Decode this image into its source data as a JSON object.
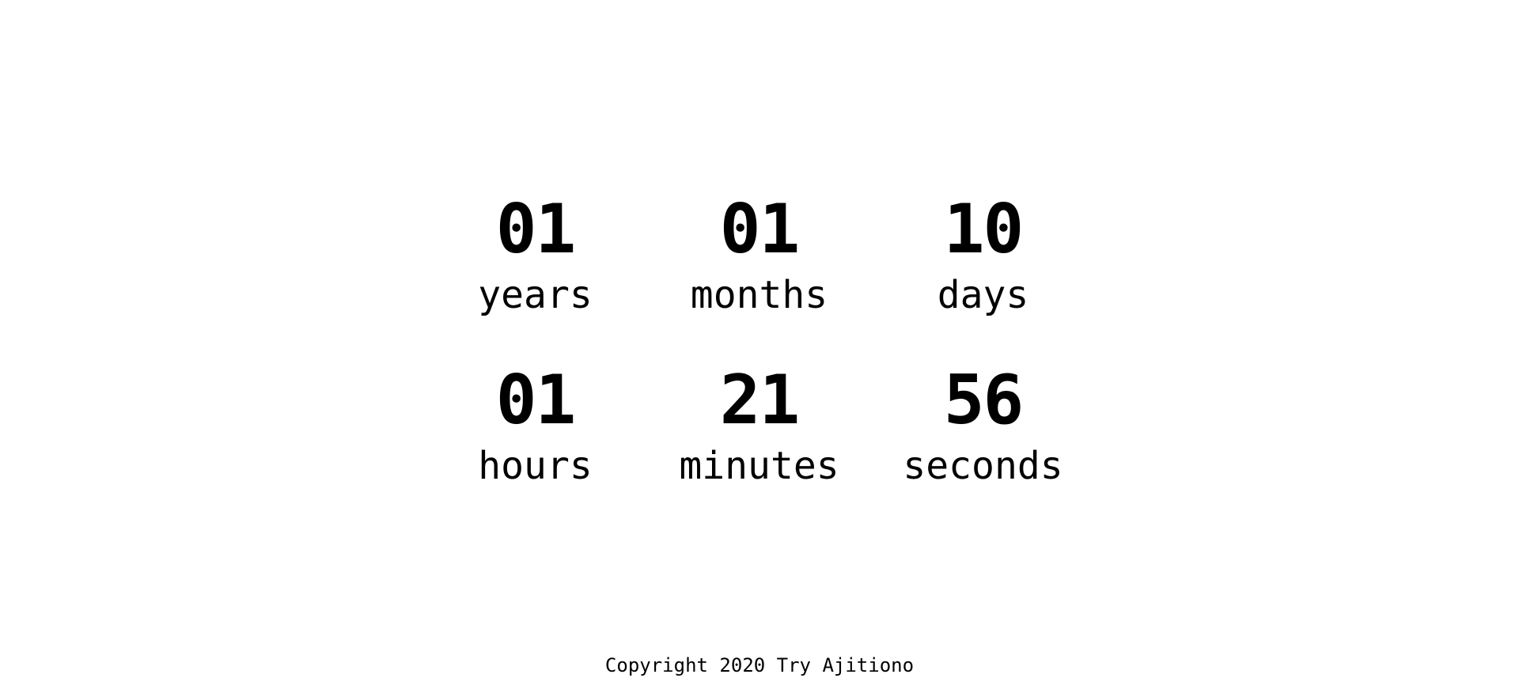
{
  "countdown": {
    "units": [
      {
        "value": "01",
        "label": "years"
      },
      {
        "value": "01",
        "label": "months"
      },
      {
        "value": "10",
        "label": "days"
      },
      {
        "value": "01",
        "label": "hours"
      },
      {
        "value": "21",
        "label": "minutes"
      },
      {
        "value": "56",
        "label": "seconds"
      }
    ]
  },
  "footer": {
    "copyright": "Copyright 2020 Try Ajitiono"
  },
  "colors": {
    "background": "#ffffff",
    "text": "#000000"
  }
}
